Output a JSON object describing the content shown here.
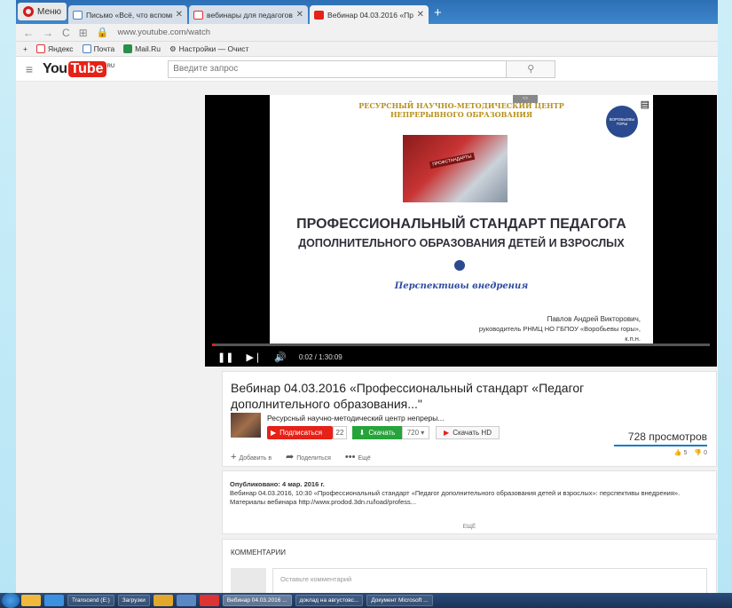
{
  "browser": {
    "menu_label": "Меню",
    "tabs": [
      {
        "label": "Письмо «Всё, что вспомн",
        "icon": "doc-icon"
      },
      {
        "label": "вебинары для педагогов",
        "icon": "yandex-icon"
      },
      {
        "label": "Вебинар 04.03.2016 «Про",
        "icon": "youtube-icon",
        "active": true
      }
    ],
    "url": "www.youtube.com/watch",
    "bookmarks": [
      "Яндекс",
      "Почта",
      "Mail.Ru",
      "Настройки — Очист"
    ]
  },
  "youtube": {
    "logo_you": "You",
    "logo_tube": "Tube",
    "logo_region": "RU",
    "search_placeholder": "Введите запрос"
  },
  "slide": {
    "header_line1": "РЕСУРСНЫЙ НАУЧНО-МЕТОДИЧЕСКИЙ ЦЕНТР",
    "header_line2": "НЕПРЕРЫВНОГО ОБРАЗОВАНИЯ",
    "logo_text": "ВОРОБЬЕВЫ ГОРЫ",
    "image_stamp": "ПРОФСТАНДАРТЫ",
    "title_line1": "ПРОФЕССИОНАЛЬНЫЙ СТАНДАРТ ПЕДАГОГА",
    "title_line2": "ДОПОЛНИТЕЛЬНОГО ОБРАЗОВАНИЯ ДЕТЕЙ И ВЗРОСЛЫХ",
    "subtitle": "Перспективы внедрения",
    "author_name": "Павлов Андрей Викторович,",
    "author_role": "руководитель РНМЦ НО ГБПОУ «Воробьевы горы»,",
    "author_degree": "к.п.н."
  },
  "player": {
    "time": "0:02 / 1:30:09",
    "progress": 0.001
  },
  "video": {
    "title": "Вебинар 04.03.2016 «Профессиональный стандарт «Педагог дополнительного образования...\"",
    "channel": "Ресурсный научно-методический центр непреры...",
    "subscribe_label": "Подписаться",
    "subscribers": "22",
    "download_label": "Скачать",
    "download_quality": "720 ▾",
    "download_hd_label": "Скачать HD",
    "views": "728 просмотров",
    "add_label": "Добавить в",
    "share_label": "Поделиться",
    "more_label": "Ещё",
    "likes": "5",
    "dislikes": "0"
  },
  "description": {
    "published": "Опубликовано: 4 мар. 2016 г.",
    "text": "Вебинар 04.03.2016, 10:30 «Профессиональный стандарт «Педагог дополнительного образования детей и взрослых»: перспективы внедрения». Материалы вебинара http://www.prodod.3dn.ru/load/profess...",
    "more": "ЕЩЁ"
  },
  "comments": {
    "title": "КОММЕНТАРИИ",
    "placeholder": "Оставьте комментарий"
  },
  "taskbar": {
    "items": [
      {
        "label": "Transcend (E:)"
      },
      {
        "label": "Загрузки"
      },
      {
        "label": "Вебинар 04.03.2016 ...",
        "active": true
      },
      {
        "label": "доклад на августовс..."
      },
      {
        "label": "Документ Microsoft ..."
      }
    ]
  }
}
